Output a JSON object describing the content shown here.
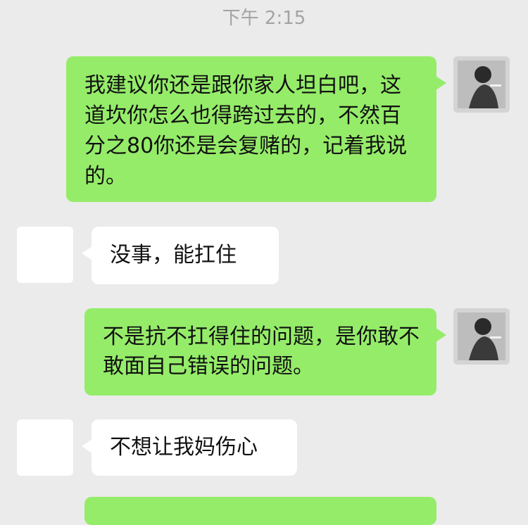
{
  "timestamp": "下午 2:15",
  "colors": {
    "background": "#ebebeb",
    "sent_bubble": "#95ec69",
    "received_bubble": "#ffffff",
    "timestamp_text": "#a3a3a3"
  },
  "messages": [
    {
      "direction": "sent",
      "text": "我建议你还是跟你家人坦白吧，这道坎你怎么也得跨过去的，不然百分之80你还是会复赌的，记着我说的。"
    },
    {
      "direction": "received",
      "text": "没事，能扛住"
    },
    {
      "direction": "sent",
      "text": "不是抗不扛得住的问题，是你敢不敢面自己错误的问题。"
    },
    {
      "direction": "received",
      "text": "不想让我妈伤心"
    }
  ]
}
